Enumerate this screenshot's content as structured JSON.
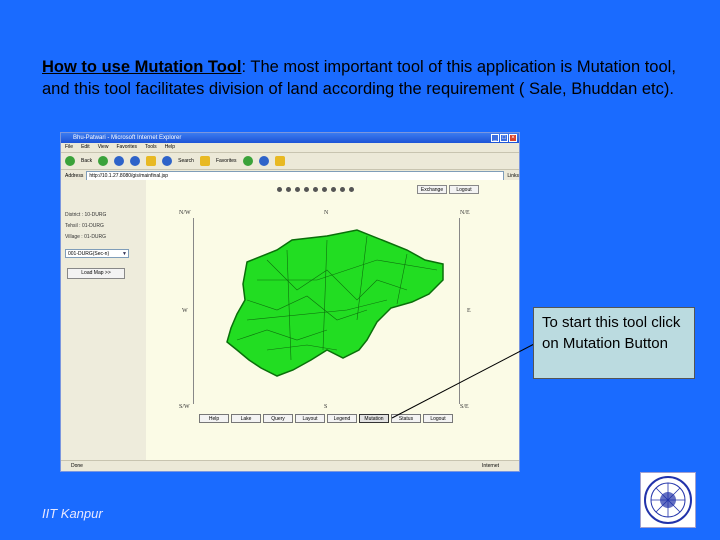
{
  "heading": {
    "lead": "How to use Mutation Tool",
    "text": ": The most important tool of this application is Mutation tool, and  this tool facilitates division   of land according the requirement  ( Sale, Bhuddan etc)."
  },
  "browser": {
    "title": "Bhu-Patwari - Microsoft Internet Explorer",
    "menu": [
      "File",
      "Edit",
      "View",
      "Favorites",
      "Tools",
      "Help"
    ],
    "toolbar": {
      "back": "Back",
      "search": "Search",
      "favorites": "Favorites"
    },
    "address_label": "Address",
    "address_value": "http://10.1.27.8080/gis/mainfinal.jsp",
    "links_label": "Links",
    "status_text": "Done",
    "zone_text": "Internet"
  },
  "app": {
    "district": "District : 10-DURG",
    "tehsil": "Tehsil : 01-DURG",
    "village": "Village : 01-DURG",
    "select_value": "001-DURG(Sec-n)",
    "load_button": "Load Map >>",
    "top_buttons": [
      "Exchange",
      "Logout"
    ],
    "compass": {
      "nw": "N/W",
      "n": "N",
      "ne": "N/E",
      "w": "W",
      "e": "E",
      "sw": "S/W",
      "s": "S",
      "se": "S/E"
    },
    "bottom_buttons": [
      "Help",
      "Lake",
      "Query",
      "Layout",
      "Legend",
      "Mutation",
      "Status",
      "Logout"
    ]
  },
  "callout": {
    "text": "To start this tool click on Mutation Button"
  },
  "footer": {
    "org": "IIT Kanpur"
  },
  "colors": {
    "background": "#1a6bff",
    "map_fill": "#22dd22",
    "callout_bg": "#bbdbe0"
  }
}
